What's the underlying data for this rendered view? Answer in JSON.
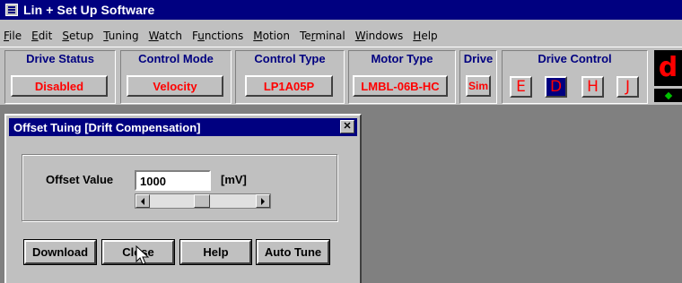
{
  "window": {
    "title": "Lin + Set Up Software"
  },
  "menu": [
    {
      "pre": "",
      "u": "F",
      "post": "ile"
    },
    {
      "pre": "",
      "u": "E",
      "post": "dit"
    },
    {
      "pre": "",
      "u": "S",
      "post": "etup"
    },
    {
      "pre": "",
      "u": "T",
      "post": "uning"
    },
    {
      "pre": "",
      "u": "W",
      "post": "atch"
    },
    {
      "pre": "F",
      "u": "u",
      "post": "nctions"
    },
    {
      "pre": "",
      "u": "M",
      "post": "otion"
    },
    {
      "pre": "Te",
      "u": "r",
      "post": "minal"
    },
    {
      "pre": "",
      "u": "W",
      "post": "indows"
    },
    {
      "pre": "",
      "u": "H",
      "post": "elp"
    }
  ],
  "toolbar": {
    "drive_status": {
      "header": "Drive Status",
      "value": "Disabled"
    },
    "control_mode": {
      "header": "Control Mode",
      "value": "Velocity"
    },
    "control_type": {
      "header": "Control Type",
      "value": "LP1A05P"
    },
    "motor_type": {
      "header": "Motor Type",
      "value": "LMBL-06B-HC"
    },
    "drive": {
      "header": "Drive",
      "value": "Sim"
    },
    "drive_control": {
      "header": "Drive Control",
      "buttons": [
        "E",
        "D",
        "H",
        "J"
      ],
      "active": "D"
    },
    "status_letter": "d"
  },
  "dialog": {
    "title": "Offset Tuing [Drift Compensation]",
    "offset_label": "Offset Value",
    "offset_value": "1000",
    "unit": "[mV]",
    "slider_position": 0.5,
    "buttons": {
      "download": "Download",
      "close": "Close",
      "help": "Help",
      "auto_tune": "Auto Tune"
    }
  },
  "colors": {
    "title_bar": "#000080",
    "accent_text": "#ff0000",
    "face": "#c0c0c0"
  }
}
